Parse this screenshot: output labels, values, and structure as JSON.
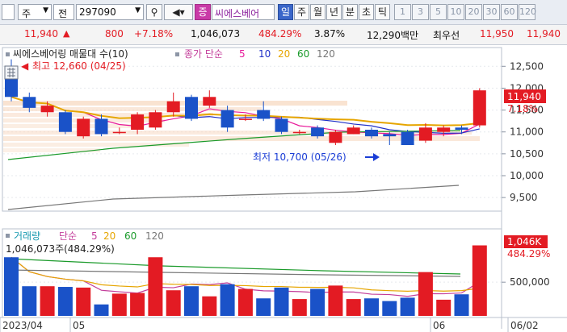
{
  "toolbar": {
    "market": "주",
    "period_type": "전",
    "code": "297090",
    "stock_name": "씨에스베어",
    "stock_badge": "증",
    "periods": [
      "일",
      "주",
      "월",
      "년",
      "분",
      "초",
      "틱"
    ],
    "active_period": "일",
    "numbers": [
      "1",
      "3",
      "5",
      "10",
      "20",
      "30",
      "60",
      "120"
    ]
  },
  "quote": {
    "price": "11,940",
    "change": "800",
    "change_pct": "+7.18%",
    "volume": "1,046,073",
    "volume_ratio": "484.29%",
    "turnover": "3.87%",
    "amount": "12,290백만",
    "best_ask_label": "최우선",
    "best_ask": "11,950",
    "best_bid": "11,940"
  },
  "price_panel": {
    "title": "씨에스베어링 매물대 수(10)",
    "ma_label": "종가 단순",
    "ma_periods": [
      "5",
      "10",
      "20",
      "60",
      "120"
    ],
    "ma_colors": [
      "#e8199a",
      "#2030c8",
      "#e6a500",
      "#1a9a2a",
      "#777777"
    ],
    "high_marker": "최고 12,660 (04/25)",
    "low_marker": "최저 10,700 (05/26)",
    "y_ticks": [
      "12,500",
      "12,000",
      "11,500",
      "11,000",
      "10,500",
      "10,000",
      "9,500"
    ],
    "last_price_tag": "11,940",
    "last_pct_tag": "7.18%"
  },
  "volume_panel": {
    "title": "거래량",
    "ma_label": "단순",
    "ma_periods": [
      "5",
      "20",
      "60",
      "120"
    ],
    "current": "1,046,073주(484.29%)",
    "y_ticks": [
      "500,000"
    ],
    "last_tag": "1,046K",
    "last_pct_tag": "484.29%"
  },
  "x_axis": [
    "2023/04",
    "05",
    "06",
    "06/02"
  ],
  "chart_data": {
    "type": "candlestick",
    "y_range": [
      9300,
      12800
    ],
    "candles": [
      {
        "o": 12500,
        "c": 11800,
        "h": 12660,
        "l": 11700
      },
      {
        "o": 11800,
        "c": 11550,
        "h": 11900,
        "l": 11450
      },
      {
        "o": 11450,
        "c": 11600,
        "h": 11700,
        "l": 11350
      },
      {
        "o": 11450,
        "c": 11000,
        "h": 11500,
        "l": 10950
      },
      {
        "o": 10900,
        "c": 11300,
        "h": 11350,
        "l": 10850
      },
      {
        "o": 11300,
        "c": 10950,
        "h": 11400,
        "l": 10900
      },
      {
        "o": 11000,
        "c": 11000,
        "h": 11100,
        "l": 10950
      },
      {
        "o": 11050,
        "c": 11400,
        "h": 11450,
        "l": 10950
      },
      {
        "o": 11100,
        "c": 11450,
        "h": 11500,
        "l": 11050
      },
      {
        "o": 11450,
        "c": 11700,
        "h": 11900,
        "l": 11350
      },
      {
        "o": 11800,
        "c": 11300,
        "h": 11850,
        "l": 11250
      },
      {
        "o": 11600,
        "c": 11800,
        "h": 11950,
        "l": 11550
      },
      {
        "o": 11500,
        "c": 11100,
        "h": 11600,
        "l": 11000
      },
      {
        "o": 11300,
        "c": 11300,
        "h": 11400,
        "l": 11250
      },
      {
        "o": 11500,
        "c": 11300,
        "h": 11700,
        "l": 11250
      },
      {
        "o": 11300,
        "c": 11000,
        "h": 11350,
        "l": 10950
      },
      {
        "o": 11000,
        "c": 11000,
        "h": 11050,
        "l": 10950
      },
      {
        "o": 11100,
        "c": 10900,
        "h": 11150,
        "l": 10850
      },
      {
        "o": 10750,
        "c": 11000,
        "h": 11050,
        "l": 10700
      },
      {
        "o": 10950,
        "c": 11100,
        "h": 11150,
        "l": 10950
      },
      {
        "o": 11050,
        "c": 10900,
        "h": 11100,
        "l": 10850
      },
      {
        "o": 10950,
        "c": 10900,
        "h": 11000,
        "l": 10700
      },
      {
        "o": 11000,
        "c": 10700,
        "h": 11050,
        "l": 10700
      },
      {
        "o": 10800,
        "c": 11100,
        "h": 11200,
        "l": 10750
      },
      {
        "o": 11000,
        "c": 11100,
        "h": 11150,
        "l": 10900
      },
      {
        "o": 11100,
        "c": 11050,
        "h": 11150,
        "l": 10950
      },
      {
        "o": 11150,
        "c": 11950,
        "h": 12000,
        "l": 11100
      }
    ],
    "volumes": [
      870000,
      440000,
      440000,
      430000,
      420000,
      170000,
      330000,
      340000,
      870000,
      380000,
      440000,
      290000,
      470000,
      400000,
      260000,
      420000,
      250000,
      400000,
      450000,
      250000,
      260000,
      220000,
      270000,
      650000,
      240000,
      320000,
      1046073
    ],
    "volume_range": [
      0,
      1100000
    ]
  }
}
